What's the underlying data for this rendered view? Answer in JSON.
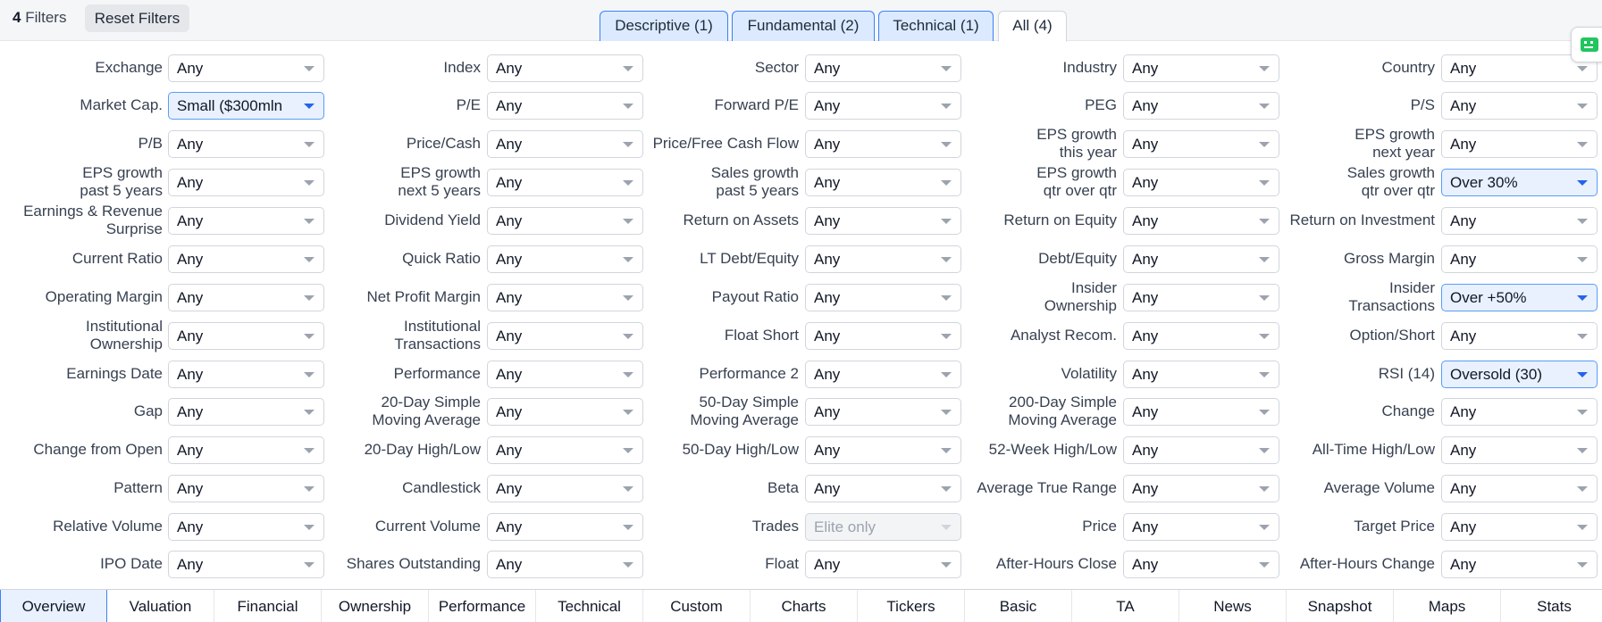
{
  "header": {
    "filters_count": "4",
    "filters_word": " Filters",
    "reset_label": "Reset Filters",
    "tabs": [
      "Descriptive (1)",
      "Fundamental (2)",
      "Technical (1)",
      "All (4)"
    ],
    "active_tab": "All (4)"
  },
  "rows": [
    [
      [
        "Exchange",
        "Any"
      ],
      [
        "Index",
        "Any"
      ],
      [
        "Sector",
        "Any"
      ],
      [
        "Industry",
        "Any"
      ],
      [
        "Country",
        "Any"
      ]
    ],
    [
      [
        "Market Cap.",
        "Small ($300mln"
      ],
      [
        "P/E",
        "Any"
      ],
      [
        "Forward P/E",
        "Any"
      ],
      [
        "PEG",
        "Any"
      ],
      [
        "P/S",
        "Any"
      ]
    ],
    [
      [
        "P/B",
        "Any"
      ],
      [
        "Price/Cash",
        "Any"
      ],
      [
        "Price/Free Cash Flow",
        "Any"
      ],
      [
        "EPS growth\nthis year",
        "Any"
      ],
      [
        "EPS growth\nnext year",
        "Any"
      ]
    ],
    [
      [
        "EPS growth\npast 5 years",
        "Any"
      ],
      [
        "EPS growth\nnext 5 years",
        "Any"
      ],
      [
        "Sales growth\npast 5 years",
        "Any"
      ],
      [
        "EPS growth\nqtr over qtr",
        "Any"
      ],
      [
        "Sales growth\nqtr over qtr",
        "Over 30%"
      ]
    ],
    [
      [
        "Earnings & Revenue\nSurprise",
        "Any"
      ],
      [
        "Dividend Yield",
        "Any"
      ],
      [
        "Return on Assets",
        "Any"
      ],
      [
        "Return on Equity",
        "Any"
      ],
      [
        "Return on Investment",
        "Any"
      ]
    ],
    [
      [
        "Current Ratio",
        "Any"
      ],
      [
        "Quick Ratio",
        "Any"
      ],
      [
        "LT Debt/Equity",
        "Any"
      ],
      [
        "Debt/Equity",
        "Any"
      ],
      [
        "Gross Margin",
        "Any"
      ]
    ],
    [
      [
        "Operating Margin",
        "Any"
      ],
      [
        "Net Profit Margin",
        "Any"
      ],
      [
        "Payout Ratio",
        "Any"
      ],
      [
        "Insider\nOwnership",
        "Any"
      ],
      [
        "Insider\nTransactions",
        "Over +50%"
      ]
    ],
    [
      [
        "Institutional\nOwnership",
        "Any"
      ],
      [
        "Institutional\nTransactions",
        "Any"
      ],
      [
        "Float Short",
        "Any"
      ],
      [
        "Analyst Recom.",
        "Any"
      ],
      [
        "Option/Short",
        "Any"
      ]
    ],
    [
      [
        "Earnings Date",
        "Any"
      ],
      [
        "Performance",
        "Any"
      ],
      [
        "Performance 2",
        "Any"
      ],
      [
        "Volatility",
        "Any"
      ],
      [
        "RSI (14)",
        "Oversold (30)"
      ]
    ],
    [
      [
        "Gap",
        "Any"
      ],
      [
        "20-Day Simple\nMoving Average",
        "Any"
      ],
      [
        "50-Day Simple\nMoving Average",
        "Any"
      ],
      [
        "200-Day Simple\nMoving Average",
        "Any"
      ],
      [
        "Change",
        "Any"
      ]
    ],
    [
      [
        "Change from Open",
        "Any"
      ],
      [
        "20-Day High/Low",
        "Any"
      ],
      [
        "50-Day High/Low",
        "Any"
      ],
      [
        "52-Week High/Low",
        "Any"
      ],
      [
        "All-Time High/Low",
        "Any"
      ]
    ],
    [
      [
        "Pattern",
        "Any"
      ],
      [
        "Candlestick",
        "Any"
      ],
      [
        "Beta",
        "Any"
      ],
      [
        "Average True Range",
        "Any"
      ],
      [
        "Average Volume",
        "Any"
      ]
    ],
    [
      [
        "Relative Volume",
        "Any"
      ],
      [
        "Current Volume",
        "Any"
      ],
      [
        "Trades",
        "Elite only"
      ],
      [
        "Price",
        "Any"
      ],
      [
        "Target Price",
        "Any"
      ]
    ],
    [
      [
        "IPO Date",
        "Any"
      ],
      [
        "Shares Outstanding",
        "Any"
      ],
      [
        "Float",
        "Any"
      ],
      [
        "After-Hours Close",
        "Any"
      ],
      [
        "After-Hours Change",
        "Any"
      ]
    ]
  ],
  "highlighted": [
    "Market Cap.",
    "Sales growth\nqtr over qtr",
    "Insider\nTransactions",
    "RSI (14)"
  ],
  "disabled": [
    "Trades"
  ],
  "bottom_tabs": [
    "Overview",
    "Valuation",
    "Financial",
    "Ownership",
    "Performance",
    "Technical",
    "Custom",
    "Charts",
    "Tickers",
    "Basic",
    "TA",
    "News",
    "Snapshot",
    "Maps",
    "Stats"
  ],
  "active_bottom_tab": "Overview",
  "icons": {
    "side": "robot-icon",
    "caret": "chevron-down-icon"
  },
  "colors": {
    "highlight_bg": "#e8f1fd",
    "highlight_border": "#5b9cf5",
    "accent": "#2563eb",
    "robot": "#22c55e"
  }
}
